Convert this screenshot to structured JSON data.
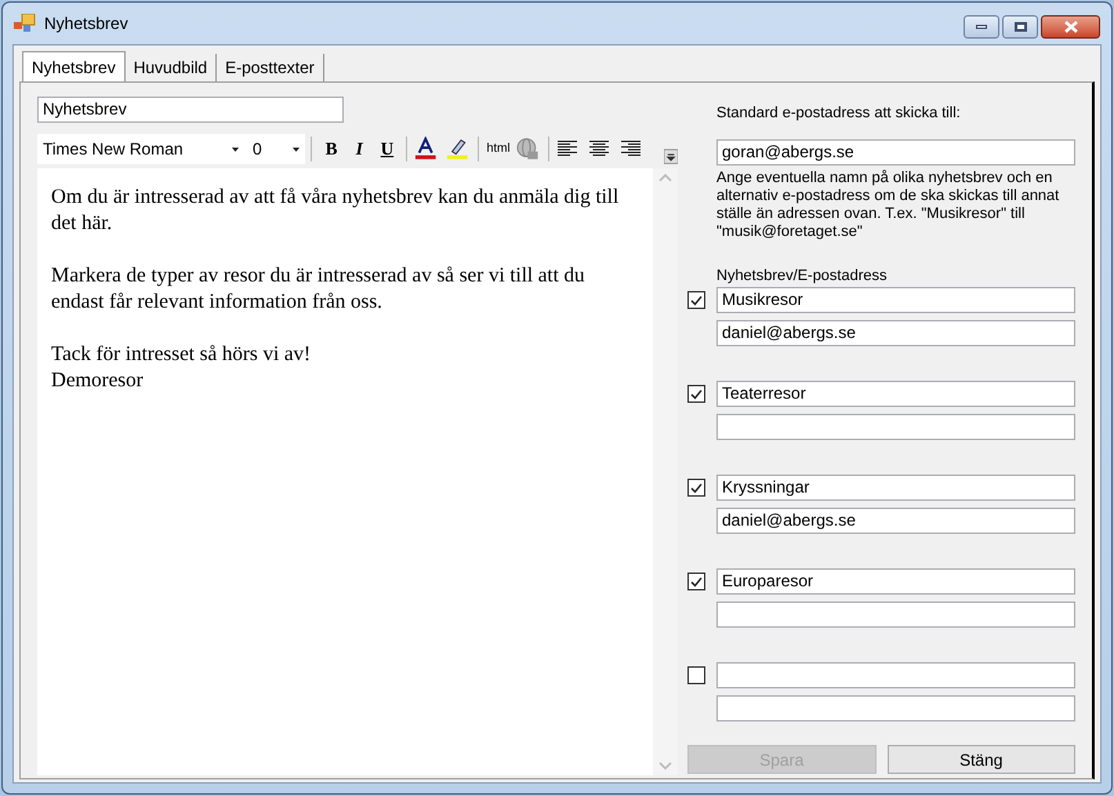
{
  "window": {
    "title": "Nyhetsbrev"
  },
  "tabs": [
    {
      "label": "Nyhetsbrev",
      "selected": true
    },
    {
      "label": "Huvudbild",
      "selected": false
    },
    {
      "label": "E-posttexter",
      "selected": false
    }
  ],
  "title_field": {
    "value": "Nyhetsbrev"
  },
  "toolbar": {
    "font": "Times New Roman",
    "size": "0",
    "bold": "B",
    "italic": "I",
    "underline": "U",
    "html": "html"
  },
  "editor": {
    "paragraphs": [
      "Om du är intresserad av att få våra nyhetsbrev kan du anmäla dig till det här.",
      "Markera de typer av resor du är intresserad av så ser vi till att du endast får relevant information från oss.",
      "Tack för intresset så hörs vi av!\nDemoresor"
    ]
  },
  "default_email": {
    "label": "Standard e-postadress att skicka till:",
    "value": "goran@abergs.se"
  },
  "help_text": "Ange eventuella namn på olika nyhetsbrev och en alternativ e-postadress om de ska skickas till annat ställe än adressen ovan. T.ex. \"Musikresor\" till \"musik@foretaget.se\"",
  "list_label": "Nyhetsbrev/E-postadress",
  "newsletters": [
    {
      "checked": true,
      "name": "Musikresor",
      "email": "daniel@abergs.se"
    },
    {
      "checked": true,
      "name": "Teaterresor"
    },
    {
      "checked": true,
      "name": "Kryssningar",
      "email": "daniel@abergs.se"
    },
    {
      "checked": true,
      "name": "Europaresor"
    },
    {
      "checked": false
    }
  ],
  "buttons": [
    {
      "label": "Spara",
      "disabled": true
    },
    {
      "label": "Stäng",
      "disabled": false
    }
  ]
}
